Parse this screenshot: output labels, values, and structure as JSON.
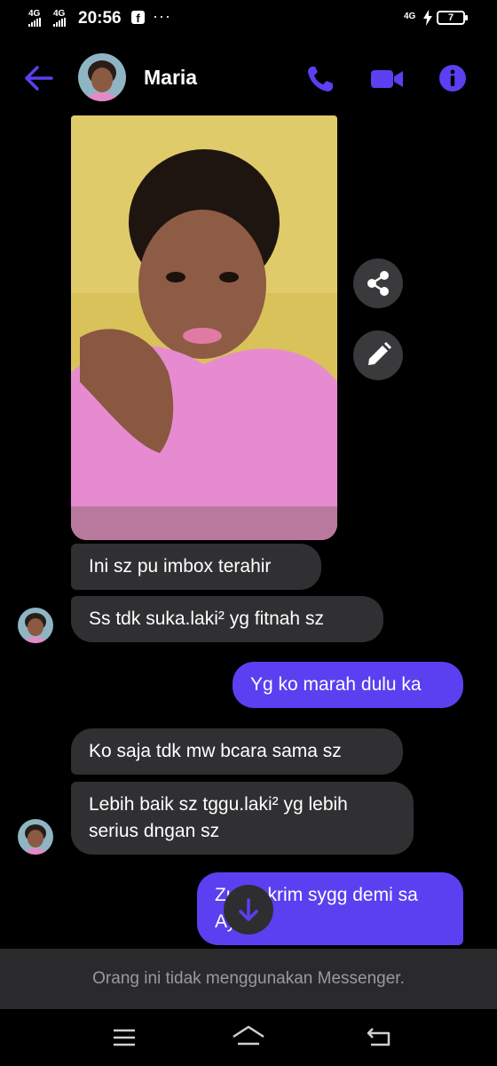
{
  "status_bar": {
    "network_1": "4G",
    "network_2": "4G",
    "time": "20:56",
    "app_icon": "facebook-icon",
    "more_indicator": "···",
    "right_network": "4G",
    "battery_level": "7"
  },
  "header": {
    "contact_name": "Maria",
    "icons": [
      "back-arrow-icon",
      "phone-icon",
      "video-camera-icon",
      "info-icon"
    ],
    "accent_color": "#5a40f0"
  },
  "photo_actions": [
    "share-icon",
    "pencil-icon"
  ],
  "messages": [
    {
      "from": "contact",
      "text": "Ini sz pu imbox terahir"
    },
    {
      "from": "contact",
      "text": "Ss tdk suka.laki² yg fitnah sz"
    },
    {
      "from": "me",
      "text": "Yg ko marah dulu ka"
    },
    {
      "from": "contact",
      "text": "Ko saja tdk mw bcara sama sz"
    },
    {
      "from": "contact",
      "text": "Lebih baik sz tggu.laki² yg lebih serius dngan sz"
    },
    {
      "from": "me",
      "text": "Zu      an krim sygg demi sa      Aya"
    }
  ],
  "notice": "Orang ini tidak menggunakan Messenger.",
  "nav_bar": [
    "menu-icon",
    "home-icon",
    "back-icon"
  ],
  "colors": {
    "sent_bubble": "#5a40f0",
    "received_bubble": "#303033",
    "background": "#000000"
  }
}
